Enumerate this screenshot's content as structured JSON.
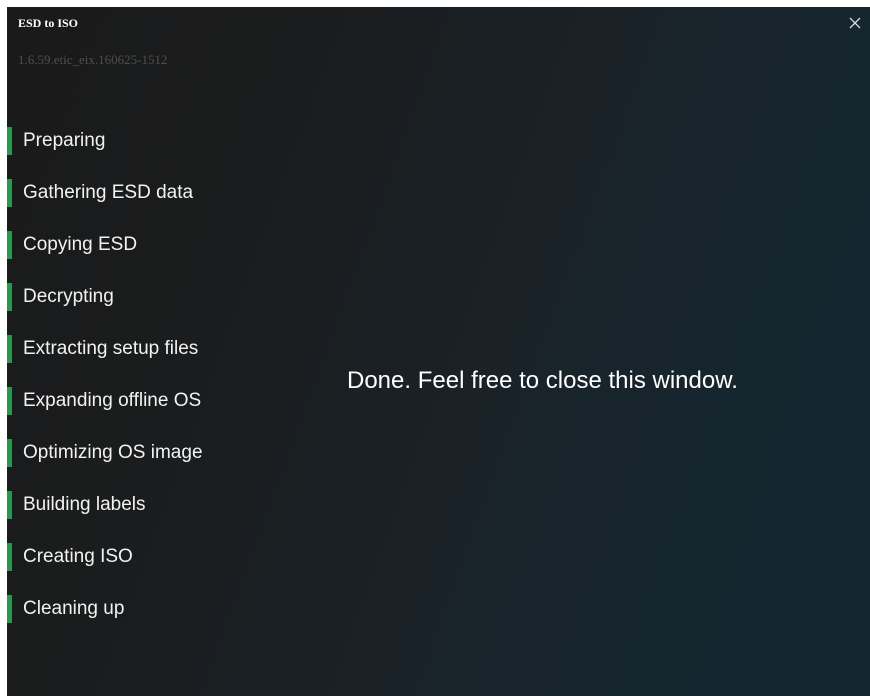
{
  "window": {
    "title": "ESD to ISO",
    "version": "1.6.59.etic_eix.160625-1512",
    "close_icon": "close-icon"
  },
  "steps": [
    {
      "label": "Preparing",
      "status": "complete"
    },
    {
      "label": "Gathering ESD data",
      "status": "complete"
    },
    {
      "label": "Copying ESD",
      "status": "complete"
    },
    {
      "label": "Decrypting",
      "status": "complete"
    },
    {
      "label": "Extracting setup files",
      "status": "complete"
    },
    {
      "label": "Expanding offline OS",
      "status": "complete"
    },
    {
      "label": "Optimizing OS image",
      "status": "complete"
    },
    {
      "label": "Building labels",
      "status": "complete"
    },
    {
      "label": "Creating ISO",
      "status": "complete"
    },
    {
      "label": "Cleaning up",
      "status": "complete"
    }
  ],
  "status_message": "Done. Feel free to close this window.",
  "colors": {
    "accent": "#1e9e4a",
    "background_start": "#1a1a1a",
    "background_end": "#13262f",
    "version_text": "#4e4e4e"
  }
}
